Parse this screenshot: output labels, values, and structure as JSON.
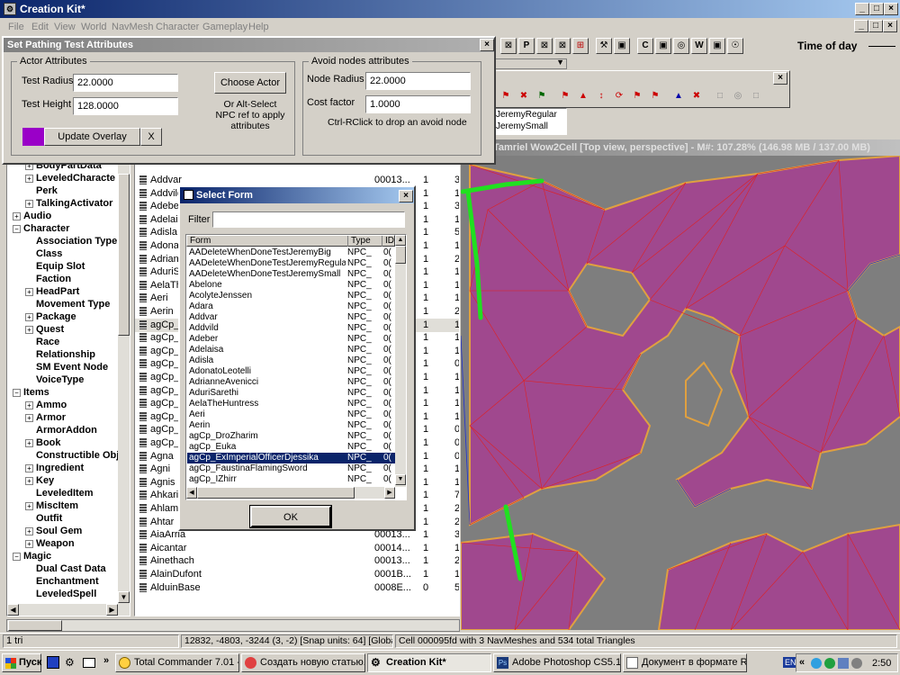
{
  "app": {
    "title": "Creation Kit*",
    "menu": [
      "File",
      "Edit",
      "View",
      "World",
      "NavMesh",
      "Character",
      "Gameplay",
      "Help"
    ],
    "time_of_day_label": "Time of day"
  },
  "toolbar1": {
    "icons": [
      "P",
      "⊠",
      "⊠",
      "⊠",
      "⊞",
      "⚒",
      "▣",
      "C",
      "▣",
      "◎",
      "W",
      "▣",
      "☉"
    ]
  },
  "toolbar2": {
    "icons": [
      "⚑",
      "✖",
      "⚑",
      "⚑",
      "▲",
      "↕",
      "⟳",
      "⚑",
      "⚑",
      "▲",
      "✖",
      "□",
      "◎",
      "□"
    ]
  },
  "float_list": {
    "items": [
      "JeremyRegular",
      "JeremySmall"
    ]
  },
  "pathing": {
    "title": "Set Pathing Test Attributes",
    "actor_group": "Actor Attributes",
    "test_radius_label": "Test Radius",
    "test_radius": "22.0000",
    "test_height_label": "Test Height",
    "test_height": "128.0000",
    "choose_actor": "Choose Actor",
    "alt_select_note": "Or Alt-Select NPC ref to apply attributes",
    "update_overlay": "Update Overlay",
    "x_label": "X",
    "overlay_color": "#9a00c8",
    "avoid_group": "Avoid nodes attributes",
    "node_radius_label": "Node Radius",
    "node_radius": "22.0000",
    "cost_factor_label": "Cost factor",
    "cost_factor": "1.0000",
    "ctrl_note": "Ctrl-RClick to drop an avoid node"
  },
  "tree": {
    "items": [
      {
        "label": "BodyPartData",
        "exp": "+",
        "indent": 1,
        "bold": true
      },
      {
        "label": "LeveledCharacte",
        "exp": "+",
        "indent": 1,
        "bold": true
      },
      {
        "label": "Perk",
        "exp": "",
        "indent": 1,
        "bold": true
      },
      {
        "label": "TalkingActivator",
        "exp": "+",
        "indent": 1,
        "bold": true
      },
      {
        "label": "Audio",
        "exp": "+",
        "indent": 0,
        "bold": true
      },
      {
        "label": "Character",
        "exp": "−",
        "indent": 0,
        "bold": true
      },
      {
        "label": "Association Type",
        "exp": "",
        "indent": 1,
        "bold": true
      },
      {
        "label": "Class",
        "exp": "",
        "indent": 1,
        "bold": true
      },
      {
        "label": "Equip Slot",
        "exp": "",
        "indent": 1,
        "bold": true
      },
      {
        "label": "Faction",
        "exp": "",
        "indent": 1,
        "bold": true
      },
      {
        "label": "HeadPart",
        "exp": "+",
        "indent": 1,
        "bold": true
      },
      {
        "label": "Movement Type",
        "exp": "",
        "indent": 1,
        "bold": true
      },
      {
        "label": "Package",
        "exp": "+",
        "indent": 1,
        "bold": true
      },
      {
        "label": "Quest",
        "exp": "+",
        "indent": 1,
        "bold": true
      },
      {
        "label": "Race",
        "exp": "",
        "indent": 1,
        "bold": true
      },
      {
        "label": "Relationship",
        "exp": "",
        "indent": 1,
        "bold": true
      },
      {
        "label": "SM Event Node",
        "exp": "",
        "indent": 1,
        "bold": true
      },
      {
        "label": "VoiceType",
        "exp": "",
        "indent": 1,
        "bold": true
      },
      {
        "label": "Items",
        "exp": "−",
        "indent": 0,
        "bold": true
      },
      {
        "label": "Ammo",
        "exp": "+",
        "indent": 1,
        "bold": true
      },
      {
        "label": "Armor",
        "exp": "+",
        "indent": 1,
        "bold": true
      },
      {
        "label": "ArmorAddon",
        "exp": "",
        "indent": 1,
        "bold": true
      },
      {
        "label": "Book",
        "exp": "+",
        "indent": 1,
        "bold": true
      },
      {
        "label": "Constructible Obj",
        "exp": "",
        "indent": 1,
        "bold": true
      },
      {
        "label": "Ingredient",
        "exp": "+",
        "indent": 1,
        "bold": true
      },
      {
        "label": "Key",
        "exp": "+",
        "indent": 1,
        "bold": true
      },
      {
        "label": "LeveledItem",
        "exp": "",
        "indent": 1,
        "bold": true
      },
      {
        "label": "MiscItem",
        "exp": "+",
        "indent": 1,
        "bold": true
      },
      {
        "label": "Outfit",
        "exp": "",
        "indent": 1,
        "bold": true
      },
      {
        "label": "Soul Gem",
        "exp": "+",
        "indent": 1,
        "bold": true
      },
      {
        "label": "Weapon",
        "exp": "+",
        "indent": 1,
        "bold": true
      },
      {
        "label": "Magic",
        "exp": "−",
        "indent": 0,
        "bold": true
      },
      {
        "label": "Dual Cast Data",
        "exp": "",
        "indent": 1,
        "bold": true
      },
      {
        "label": "Enchantment",
        "exp": "",
        "indent": 1,
        "bold": true
      },
      {
        "label": "LeveledSpell",
        "exp": "",
        "indent": 1,
        "bold": true
      }
    ]
  },
  "objgrid": {
    "rows": [
      {
        "name": "Addvar",
        "id": "00013...",
        "c1": "1",
        "c2": "3"
      },
      {
        "name": "Addvild",
        "id": "",
        "c1": "1",
        "c2": "1"
      },
      {
        "name": "Adeber",
        "id": "",
        "c1": "1",
        "c2": "3"
      },
      {
        "name": "Adelaisa",
        "id": "",
        "c1": "1",
        "c2": "1"
      },
      {
        "name": "Adisla",
        "id": "",
        "c1": "1",
        "c2": "5"
      },
      {
        "name": "Adonato",
        "id": "",
        "c1": "1",
        "c2": "1"
      },
      {
        "name": "Adrianne",
        "id": "",
        "c1": "1",
        "c2": "2"
      },
      {
        "name": "AduriS",
        "id": "",
        "c1": "1",
        "c2": "1"
      },
      {
        "name": "AelaTh",
        "id": "",
        "c1": "1",
        "c2": "17"
      },
      {
        "name": "Aeri",
        "id": "",
        "c1": "1",
        "c2": "1"
      },
      {
        "name": "Aerin",
        "id": "",
        "c1": "1",
        "c2": "2"
      },
      {
        "name": "agCp_",
        "id": "",
        "c1": "1",
        "c2": "1"
      },
      {
        "name": "agCp_",
        "id": "",
        "c1": "1",
        "c2": "1"
      },
      {
        "name": "agCp_",
        "id": "",
        "c1": "1",
        "c2": "1"
      },
      {
        "name": "agCp_",
        "id": "",
        "c1": "1",
        "c2": "0"
      },
      {
        "name": "agCp_",
        "id": "",
        "c1": "1",
        "c2": "1"
      },
      {
        "name": "agCp_",
        "id": "",
        "c1": "1",
        "c2": "1"
      },
      {
        "name": "agCp_",
        "id": "",
        "c1": "1",
        "c2": "1"
      },
      {
        "name": "agCp_",
        "id": "",
        "c1": "1",
        "c2": "1"
      },
      {
        "name": "agCp_",
        "id": "",
        "c1": "1",
        "c2": "0"
      },
      {
        "name": "agCp_",
        "id": "",
        "c1": "1",
        "c2": "0"
      },
      {
        "name": "Agna",
        "id": "",
        "c1": "1",
        "c2": "0"
      },
      {
        "name": "Agni",
        "id": "",
        "c1": "1",
        "c2": "1"
      },
      {
        "name": "Agnis",
        "id": "",
        "c1": "1",
        "c2": "1"
      },
      {
        "name": "Ahkari",
        "id": "",
        "c1": "1",
        "c2": "7"
      },
      {
        "name": "Ahlam",
        "id": "",
        "c1": "1",
        "c2": "2"
      },
      {
        "name": "Ahtar",
        "id": "",
        "c1": "1",
        "c2": "2"
      },
      {
        "name": "AiaArria",
        "id": "00013...",
        "c1": "1",
        "c2": "3"
      },
      {
        "name": "Aicantar",
        "id": "00014...",
        "c1": "1",
        "c2": "1"
      },
      {
        "name": "Ainethach",
        "id": "00013...",
        "c1": "1",
        "c2": "2"
      },
      {
        "name": "AlainDufont",
        "id": "0001B...",
        "c1": "1",
        "c2": "1"
      },
      {
        "name": "AlduinBase",
        "id": "0008E...",
        "c1": "0",
        "c2": "5"
      }
    ]
  },
  "selectform": {
    "title": "Select Form",
    "filter_label": "Filter",
    "filter_value": "",
    "col_form": "Form",
    "col_type": "Type",
    "col_id": "ID",
    "rows": [
      {
        "form": "AADeleteWhenDoneTestJeremyBig",
        "type": "NPC_",
        "id": "0("
      },
      {
        "form": "AADeleteWhenDoneTestJeremyRegular",
        "type": "NPC_",
        "id": "0("
      },
      {
        "form": "AADeleteWhenDoneTestJeremySmall",
        "type": "NPC_",
        "id": "0("
      },
      {
        "form": "Abelone",
        "type": "NPC_",
        "id": "0("
      },
      {
        "form": "AcolyteJenssen",
        "type": "NPC_",
        "id": "0("
      },
      {
        "form": "Adara",
        "type": "NPC_",
        "id": "0("
      },
      {
        "form": "Addvar",
        "type": "NPC_",
        "id": "0("
      },
      {
        "form": "Addvild",
        "type": "NPC_",
        "id": "0("
      },
      {
        "form": "Adeber",
        "type": "NPC_",
        "id": "0("
      },
      {
        "form": "Adelaisa",
        "type": "NPC_",
        "id": "0("
      },
      {
        "form": "Adisla",
        "type": "NPC_",
        "id": "0("
      },
      {
        "form": "AdonatoLeotelli",
        "type": "NPC_",
        "id": "0("
      },
      {
        "form": "AdrianneAvenicci",
        "type": "NPC_",
        "id": "0("
      },
      {
        "form": "AduriSarethi",
        "type": "NPC_",
        "id": "0("
      },
      {
        "form": "AelaTheHuntress",
        "type": "NPC_",
        "id": "0("
      },
      {
        "form": "Aeri",
        "type": "NPC_",
        "id": "0("
      },
      {
        "form": "Aerin",
        "type": "NPC_",
        "id": "0("
      },
      {
        "form": "agCp_DroZharim",
        "type": "NPC_",
        "id": "0("
      },
      {
        "form": "agCp_Euka",
        "type": "NPC_",
        "id": "0("
      },
      {
        "form": "agCp_ExImperialOfficerDjessika",
        "type": "NPC_",
        "id": "0("
      },
      {
        "form": "agCp_FaustinaFlamingSword",
        "type": "NPC_",
        "id": "0("
      },
      {
        "form": "agCp_IZhirr",
        "type": "NPC_",
        "id": "0("
      }
    ],
    "selected_index": 19,
    "ok_label": "OK"
  },
  "render": {
    "title": "Tamriel Wow2Cell [Top view, perspective] - M#: 107.28% (146.98 MB / 137.00 MB)",
    "nav_color": "#a0488e",
    "ground_color": "#7e7e7e"
  },
  "status": {
    "left": "1 tri",
    "coords": "12832, -4803, -3244 (3, -2) [Snap units: 64] [Global]",
    "cell": "Cell 000095fd with 3 NavMeshes and 534 total Triangles"
  },
  "taskbar": {
    "start": "Пуск",
    "tasks": [
      "Total Commander 7.01 - ...",
      "Создать новую статью...",
      "Creation Kit*",
      "Adobe Photoshop CS5.1 ...",
      "Документ в формате R..."
    ],
    "lang": "EN",
    "clock": "2:50"
  }
}
